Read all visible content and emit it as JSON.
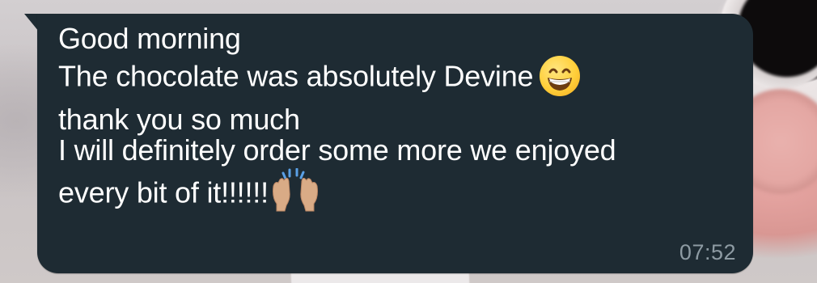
{
  "message": {
    "lines": [
      "Good morning",
      "The chocolate was absolutely Devine",
      "thank you so much",
      "I will definitely order some more we enjoyed",
      "every bit of it!!!!!!"
    ],
    "emojis": {
      "line2": "grinning-face-with-smiling-eyes-icon",
      "line5": "raising-hands-icon"
    },
    "timestamp": "07:52"
  },
  "colors": {
    "bubble": "#1e2b33",
    "text": "#ffffff",
    "timestamp": "#8e9ba3"
  }
}
